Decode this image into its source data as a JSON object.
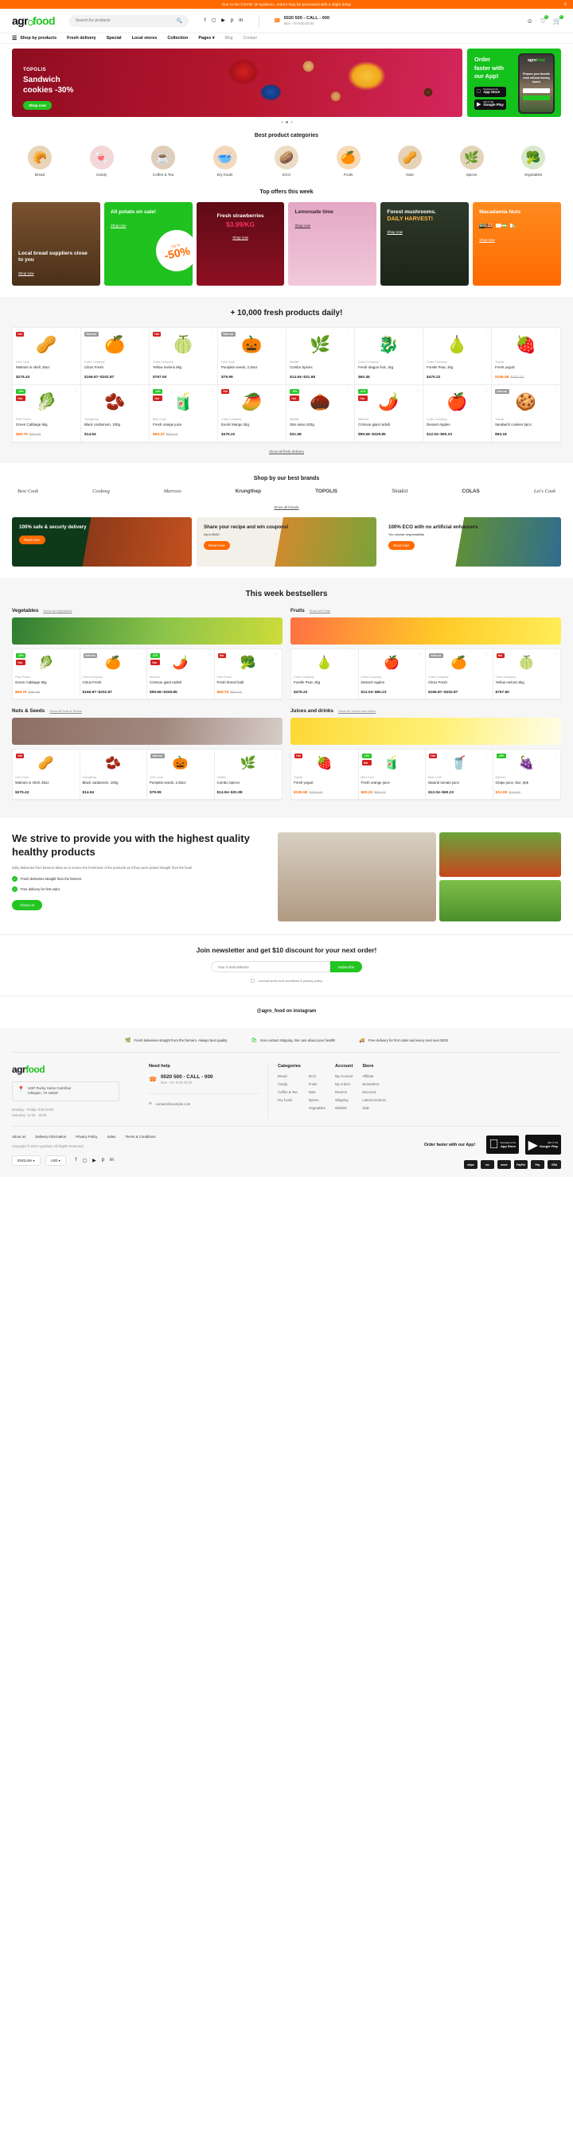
{
  "topbar": {
    "message": "Due to the COVID 19 epidemic, orders may be processed with a slight delay",
    "close": "X"
  },
  "header": {
    "logo_part1": "agr",
    "logo_part2": "food",
    "search_placeholder": "Search for products",
    "phone": "0020 500 - CALL - 000",
    "phone_hours": "Mon - Fri 9:00-20:00",
    "wishlist_count": "0",
    "cart_count": "0"
  },
  "nav": {
    "shop_by_products": "Shop by products",
    "items": [
      {
        "label": "Fresh delivery",
        "style": "bold"
      },
      {
        "label": "Special",
        "style": "bold"
      },
      {
        "label": "Local stores",
        "style": "bold"
      },
      {
        "label": "Collection",
        "style": "bold"
      },
      {
        "label": "Pages",
        "style": "bold-caret"
      },
      {
        "label": "Blog",
        "style": "light"
      },
      {
        "label": "Contact",
        "style": "light"
      }
    ]
  },
  "hero": {
    "kicker": "TOPOLIS",
    "title": "Sandwich\ncookies -30%",
    "cta": "Shop now",
    "side_title": "Order faster with our App!",
    "appstore_small": "Download on the",
    "appstore_big": "App Store",
    "google_small": "GET IT ON",
    "google_big": "Google Play",
    "app_logo1": "agro",
    "app_logo2": "food",
    "app_text": "Prepare your favorite meal without leaving home!"
  },
  "categories_section": {
    "title": "Best product categories",
    "items": [
      {
        "label": "Bread",
        "icon": "bread-icon",
        "glyph": "🥖",
        "bg": "#e8d5b7"
      },
      {
        "label": "Candy",
        "icon": "candy-icon",
        "glyph": "🍬",
        "bg": "#f3d7d7"
      },
      {
        "label": "Coffee & Tea",
        "icon": "coffee-icon",
        "glyph": "☕",
        "bg": "#e0cdbb"
      },
      {
        "label": "Dry foods",
        "icon": "dryfoods-icon",
        "glyph": "🥣",
        "bg": "#f2d9bd"
      },
      {
        "label": "ECO",
        "icon": "eco-icon",
        "glyph": "🥔",
        "bg": "#ecdcc6"
      },
      {
        "label": "Fruits",
        "icon": "fruits-icon",
        "glyph": "🍊",
        "bg": "#f7d9b4"
      },
      {
        "label": "Nuts",
        "icon": "nuts-icon",
        "glyph": "🥜",
        "bg": "#e6d2b6"
      },
      {
        "label": "Spices",
        "icon": "spices-icon",
        "glyph": "🌿",
        "bg": "#e3d3b9"
      },
      {
        "label": "Vegetables",
        "icon": "vegetables-icon",
        "glyph": "🥬",
        "bg": "#d9e8cc"
      }
    ]
  },
  "top_offers": {
    "title": "Top offers this week",
    "items": [
      {
        "id": "o1",
        "title": "Local bread suppliers close to you",
        "cta": "Shop now"
      },
      {
        "id": "o2",
        "title": "All potato on sale!",
        "cta": "Shop now",
        "upto": "Up to",
        "discount": "-50%"
      },
      {
        "id": "o3",
        "title": "Fresh strawberries",
        "price": "$3.99/KG",
        "cta": "Shop now"
      },
      {
        "id": "o4",
        "title": "Lemonade time",
        "cta": "Shop now"
      },
      {
        "id": "o5",
        "title": "Forest mushrooms.",
        "highlight": "DAILY HARVEST!",
        "cta": "Shop now"
      },
      {
        "id": "o6",
        "title": "Macadamia Nuts",
        "price": "$60.23",
        "old_price": "$60.74",
        "unit": "/kg",
        "cta": "Shop now"
      }
    ]
  },
  "fresh": {
    "title": "+ 10,000 fresh products daily!",
    "show_all": "Show all fresh delivery",
    "products": [
      {
        "brand": "Let's Cook",
        "name": "Walnuts in shell, 35oz",
        "price": "$275.43",
        "glyph": "🥜",
        "tags": [
          {
            "t": "Hot",
            "c": "hot"
          }
        ]
      },
      {
        "brand": "Coles Company",
        "name": "Citrus Fresh",
        "price": "$166.87–$202.87",
        "glyph": "🍊",
        "tags": [
          {
            "t": "Sold out",
            "c": "sold"
          }
        ]
      },
      {
        "brand": "Coles Company",
        "name": "Yellow melons 5kg",
        "price": "$767.50",
        "glyph": "🍈",
        "tags": [
          {
            "t": "Hot",
            "c": "hot"
          }
        ]
      },
      {
        "brand": "Let's Cook",
        "name": "Pumpkin seeds, 2.25oz",
        "price": "$79.99",
        "glyph": "🎃",
        "tags": [
          {
            "t": "Sold out",
            "c": "sold"
          }
        ]
      },
      {
        "brand": "Skialist",
        "name": "Combo Spices",
        "price": "$14.94–$31.98",
        "glyph": "🌿",
        "tags": []
      },
      {
        "brand": "Coles Company",
        "name": "Fresh dragon fruit, 1kg",
        "price": "$60.45",
        "glyph": "🐉",
        "tags": []
      },
      {
        "brand": "Coles Company",
        "name": "Forelle Pear, 2kg",
        "price": "$475.22",
        "glyph": "🍐",
        "tags": []
      },
      {
        "brand": "Topolis",
        "name": "Fresh yogurt",
        "price": "$106.58",
        "old_price": "$202.87",
        "sale": true,
        "glyph": "🍓",
        "tags": []
      },
      {
        "brand": "Pear Prown",
        "name": "Green Cabbage 5kg",
        "price": "$69.75",
        "old_price": "$98.66",
        "sale": true,
        "glyph": "🥬",
        "tags": [
          {
            "t": "-29%",
            "c": "disc"
          },
          {
            "t": "Hot",
            "c": "hot"
          }
        ]
      },
      {
        "brand": "Youngshop",
        "name": "Black cardamom, 100g",
        "price": "$14.94",
        "glyph": "🫘",
        "tags": []
      },
      {
        "brand": "Best Cook",
        "name": "Fresh orange juice",
        "price": "$60.23",
        "old_price": "$60.74",
        "sale": true,
        "glyph": "🧃",
        "tags": [
          {
            "t": "-13%",
            "c": "disc"
          },
          {
            "t": "Hot",
            "c": "hot"
          }
        ]
      },
      {
        "brand": "Coles Company",
        "name": "Exotic Mango 2kg",
        "price": "$475.22",
        "glyph": "🥭",
        "tags": [
          {
            "t": "Hot",
            "c": "hot"
          }
        ]
      },
      {
        "brand": "Skialist",
        "name": "Star anise,100g",
        "price": "$31.98",
        "glyph": "🌰",
        "tags": [
          {
            "t": "-72%",
            "c": "disc"
          },
          {
            "t": "Hot",
            "c": "hot"
          }
        ]
      },
      {
        "brand": "Marrezo",
        "name": "Crimson giant radish",
        "price": "$99.66–$328.85",
        "glyph": "🌶️",
        "tags": [
          {
            "t": "-67%",
            "c": "disc"
          },
          {
            "t": "Hot",
            "c": "hot"
          }
        ]
      },
      {
        "brand": "Coles Company",
        "name": "Dessert Apples",
        "price": "$12.04–$60.23",
        "glyph": "🍎",
        "tags": []
      },
      {
        "brand": "Topolis",
        "name": "Sandwich cookies 5pcs",
        "price": "$94.18",
        "glyph": "🍪",
        "tags": [
          {
            "t": "Sold out",
            "c": "sold"
          }
        ]
      }
    ]
  },
  "brands_section": {
    "title": "Shop by our best brands",
    "show_all": "Show all brands",
    "brands": [
      "Best Cook",
      "Cooking",
      "Marrezo",
      "Krungthep",
      "TOPOLIS",
      "Skialist",
      "COLAS",
      "Let's Cook"
    ]
  },
  "promos": [
    {
      "title": "100% safe & securly delivery",
      "cta": "Read more",
      "cls": "p1"
    },
    {
      "title": "Share your recipe and win coupons!",
      "sub": "Up to $100",
      "cta": "Read more",
      "cls": "p2"
    },
    {
      "title": "100% ECO with no artificial enhancers",
      "sub": "You choose responsibility",
      "cta": "Read more",
      "cls": "p3"
    }
  ],
  "bestsellers": {
    "title": "This week bestsellers",
    "groups": [
      {
        "name": "Vegetables",
        "show_all": "Show all Vegetables",
        "banner": "veg",
        "products": [
          {
            "brand": "Pear Prown",
            "name": "Green Cabbage 5kg",
            "price": "$69.75",
            "old_price": "$98.66",
            "sale": true,
            "glyph": "🥬",
            "tags": [
              {
                "t": "-29%",
                "c": "disc"
              },
              {
                "t": "Hot",
                "c": "hot"
              }
            ]
          },
          {
            "brand": "Coles Company",
            "name": "Citrus Fresh",
            "price": "$166.87–$202.87",
            "glyph": "🍊",
            "tags": [
              {
                "t": "Sold out",
                "c": "sold"
              }
            ]
          },
          {
            "brand": "Marrezo",
            "name": "Crimson giant radish",
            "price": "$99.66–$328.85",
            "glyph": "🌶️",
            "tags": [
              {
                "t": "-67%",
                "c": "disc"
              },
              {
                "t": "Hot",
                "c": "hot"
              }
            ]
          },
          {
            "brand": "Pear Prown",
            "name": "Fresh fennel bulb",
            "price": "$69.75",
            "old_price": "$94.18",
            "sale": true,
            "glyph": "🥦",
            "tags": [
              {
                "t": "Hot",
                "c": "hot"
              }
            ]
          }
        ]
      },
      {
        "name": "Fruits",
        "show_all": "Show all Fruits",
        "banner": "fruit",
        "products": [
          {
            "brand": "Coles Company",
            "name": "Forelle Pear, 2kg",
            "price": "$475.22",
            "glyph": "🍐",
            "tags": []
          },
          {
            "brand": "Coles Company",
            "name": "Dessert Apples",
            "price": "$12.04–$60.23",
            "glyph": "🍎",
            "tags": []
          },
          {
            "brand": "Coles Company",
            "name": "Citrus Fresh",
            "price": "$166.87–$202.87",
            "glyph": "🍊",
            "tags": [
              {
                "t": "Sold out",
                "c": "sold"
              }
            ]
          },
          {
            "brand": "Coles Company",
            "name": "Yellow melons 5kg",
            "price": "$767.50",
            "glyph": "🍈",
            "tags": [
              {
                "t": "Hot",
                "c": "hot"
              }
            ]
          }
        ]
      },
      {
        "name": "Nuts & Seeds",
        "show_all": "Show all Nuts & Seeds",
        "banner": "nuts",
        "products": [
          {
            "brand": "Let's Cook",
            "name": "Walnuts in shell, 35oz",
            "price": "$275.43",
            "glyph": "🥜",
            "tags": [
              {
                "t": "Hot",
                "c": "hot"
              }
            ]
          },
          {
            "brand": "Youngshop",
            "name": "Black cardamom, 100g",
            "price": "$14.94",
            "glyph": "🫘",
            "tags": []
          },
          {
            "brand": "Let's Cook",
            "name": "Pumpkin seeds, 2.25oz",
            "price": "$79.99",
            "glyph": "🎃",
            "tags": [
              {
                "t": "Sold out",
                "c": "sold"
              }
            ]
          },
          {
            "brand": "Skialist",
            "name": "Combo Spices",
            "price": "$14.94–$31.98",
            "glyph": "🌿",
            "tags": []
          }
        ]
      },
      {
        "name": "Juices and drinks",
        "show_all": "Show all Juices and drinks",
        "banner": "juice",
        "products": [
          {
            "brand": "Topolis",
            "name": "Fresh yogurt",
            "price": "$106.58",
            "old_price": "$202.87",
            "sale": true,
            "glyph": "🍓",
            "tags": [
              {
                "t": "Hot",
                "c": "hot"
              }
            ]
          },
          {
            "brand": "Best Cook",
            "name": "Fresh orange juice",
            "price": "$60.23",
            "old_price": "$60.74",
            "sale": true,
            "glyph": "🧃",
            "tags": [
              {
                "t": "-13%",
                "c": "disc"
              },
              {
                "t": "Hot",
                "c": "hot"
              }
            ]
          },
          {
            "brand": "Best Cook",
            "name": "Natural tomato juice",
            "price": "$12.04–$60.23",
            "glyph": "🥤",
            "tags": [
              {
                "t": "Hot",
                "c": "hot"
              }
            ]
          },
          {
            "brand": "Marrezo",
            "name": "Grape juice, 8oz, 6pk",
            "price": "$12.08",
            "old_price": "$19.99",
            "sale": true,
            "glyph": "🍇",
            "tags": [
              {
                "t": "-40%",
                "c": "disc"
              }
            ]
          }
        ]
      }
    ]
  },
  "strive": {
    "title": "We strive to provide you with the highest quality healthy products",
    "paragraph": "Daily deliveries from farmers allow us to ensure the freshness of the products as if they were picked straight from the bush.",
    "features": [
      "Fresh deliveries straight from the farmers",
      "Free delivery for first order"
    ],
    "cta": "About us"
  },
  "newsletter": {
    "title": "Join newsletter and get $10 discount for your next order!",
    "placeholder": "Your e-mail address",
    "button": "Subscribe",
    "consent": "I accept terms and conditions & privacy policy"
  },
  "instagram": {
    "handle": "@agro_food on instagram"
  },
  "footer": {
    "features": [
      {
        "icon": "leaf-icon",
        "glyph": "🌿",
        "text": "Fresh deliveries straight from the farmers. Always best quality"
      },
      {
        "icon": "bag-icon",
        "glyph": "🛍",
        "text": "Non-contact shipping. We care about your health!"
      },
      {
        "icon": "truck-icon",
        "glyph": "🚚",
        "text": "Free delivery for first order and every next over $200"
      }
    ],
    "logo_part1": "agr",
    "logo_part2": "food",
    "address_line1": "1487 Rocky Horse Carrefour",
    "address_line2": "Arlington, TX 16819",
    "hours_line1": "Monday - Friday: 9:00-20:00",
    "hours_line2": "Saturday: 11:00 - 15:00",
    "help_title": "Need help",
    "help_phone": "0020 500 - CALL - 000",
    "help_hours": "Mon - Fri: 9:00-20:00",
    "help_email": "contact@example.com",
    "col_categories_title": "Categories",
    "categories_a": [
      "Bread",
      "Candy",
      "Coffee & Tea",
      "Dry foods"
    ],
    "categories_b": [
      "ECO",
      "Fruits",
      "Nuts",
      "Spices",
      "Vegetables"
    ],
    "col_account_title": "Account",
    "account": [
      "My Account",
      "My orders",
      "Returns",
      "Shipping",
      "Wishlist"
    ],
    "col_store_title": "Store",
    "store": [
      "Affiliate",
      "Bestsellers",
      "Discount",
      "Latest products",
      "Sale"
    ],
    "bottom_links": [
      "About us",
      "Delivery information",
      "Privacy Policy",
      "Sales",
      "Terms & Conditions"
    ],
    "copyright": "Copyright © 2022 Agrofood. All Rights Reserved.",
    "language": "ENGLISH",
    "currency": "USD",
    "order_app": "Order faster with our App!",
    "appstore_small": "Download on the",
    "appstore_big": "App Store",
    "google_small": "GET IT ON",
    "google_big": "Google Play",
    "payments": [
      "stripe",
      "mc",
      "amex",
      "PayPal",
      "Pay",
      "VISA"
    ]
  }
}
